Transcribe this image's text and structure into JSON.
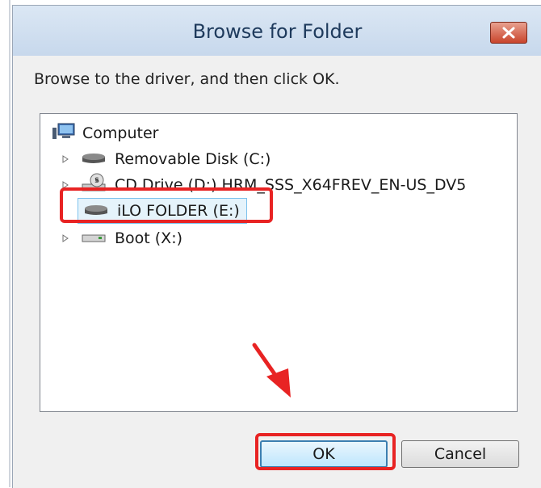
{
  "dialog": {
    "title": "Browse for Folder",
    "instruction": "Browse to the driver, and then click OK."
  },
  "tree": {
    "root": {
      "label": "Computer",
      "icon": "computer-icon"
    },
    "items": [
      {
        "label": "Removable Disk (C:)",
        "icon": "drive-icon",
        "expandable": true,
        "selected": false
      },
      {
        "label": "CD Drive (D:) HRM_SSS_X64FREV_EN-US_DV5",
        "icon": "cd-drive-icon",
        "expandable": true,
        "selected": false
      },
      {
        "label": "iLO FOLDER (E:)",
        "icon": "drive-icon",
        "expandable": false,
        "selected": true
      },
      {
        "label": "Boot (X:)",
        "icon": "drive-icon",
        "expandable": true,
        "selected": false
      }
    ]
  },
  "buttons": {
    "ok": "OK",
    "cancel": "Cancel"
  },
  "colors": {
    "highlight": "#e82323",
    "selection_bg": "#e5f3fb",
    "selection_border": "#7dc2ed"
  }
}
